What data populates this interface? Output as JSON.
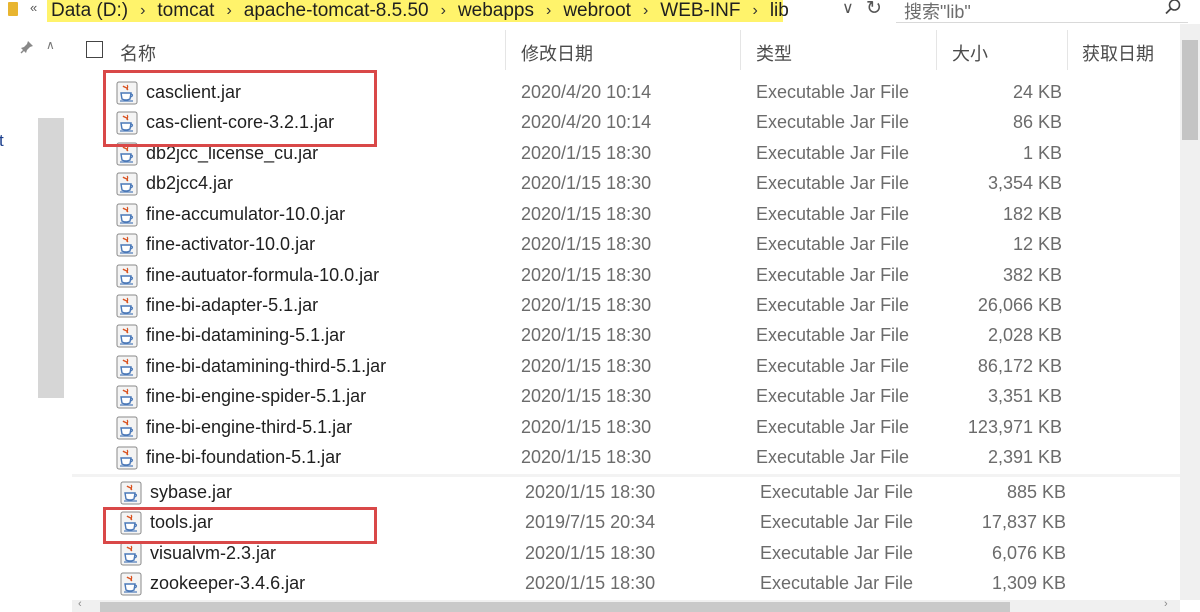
{
  "address": {
    "back_glyph": "«",
    "crumbs": [
      "Data (D:)",
      "tomcat",
      "apache-tomcat-8.5.50",
      "webapps",
      "webroot",
      "WEB-INF",
      "lib"
    ],
    "separator": "›",
    "dropdown_glyph": "∨",
    "refresh_glyph": "↻",
    "highlight_color": "#fff36b"
  },
  "search": {
    "placeholder": "搜索\"lib\"",
    "icon": "search-icon"
  },
  "nav": {
    "pin_glyph": "📌",
    "fragment": "t",
    "up_glyph": "∧"
  },
  "columns": {
    "name": "名称",
    "date": "修改日期",
    "type": "类型",
    "size": "大小",
    "acquired": "获取日期"
  },
  "files": [
    {
      "name": "casclient.jar",
      "date": "2020/4/20 10:14",
      "type": "Executable Jar File",
      "size": "24 KB"
    },
    {
      "name": "cas-client-core-3.2.1.jar",
      "date": "2020/4/20 10:14",
      "type": "Executable Jar File",
      "size": "86 KB"
    },
    {
      "name": "db2jcc_license_cu.jar",
      "date": "2020/1/15 18:30",
      "type": "Executable Jar File",
      "size": "1 KB"
    },
    {
      "name": "db2jcc4.jar",
      "date": "2020/1/15 18:30",
      "type": "Executable Jar File",
      "size": "3,354 KB"
    },
    {
      "name": "fine-accumulator-10.0.jar",
      "date": "2020/1/15 18:30",
      "type": "Executable Jar File",
      "size": "182 KB"
    },
    {
      "name": "fine-activator-10.0.jar",
      "date": "2020/1/15 18:30",
      "type": "Executable Jar File",
      "size": "12 KB"
    },
    {
      "name": "fine-autuator-formula-10.0.jar",
      "date": "2020/1/15 18:30",
      "type": "Executable Jar File",
      "size": "382 KB"
    },
    {
      "name": "fine-bi-adapter-5.1.jar",
      "date": "2020/1/15 18:30",
      "type": "Executable Jar File",
      "size": "26,066 KB"
    },
    {
      "name": "fine-bi-datamining-5.1.jar",
      "date": "2020/1/15 18:30",
      "type": "Executable Jar File",
      "size": "2,028 KB"
    },
    {
      "name": "fine-bi-datamining-third-5.1.jar",
      "date": "2020/1/15 18:30",
      "type": "Executable Jar File",
      "size": "86,172 KB"
    },
    {
      "name": "fine-bi-engine-spider-5.1.jar",
      "date": "2020/1/15 18:30",
      "type": "Executable Jar File",
      "size": "3,351 KB"
    },
    {
      "name": "fine-bi-engine-third-5.1.jar",
      "date": "2020/1/15 18:30",
      "type": "Executable Jar File",
      "size": "123,971 KB"
    },
    {
      "name": "fine-bi-foundation-5.1.jar",
      "date": "2020/1/15 18:30",
      "type": "Executable Jar File",
      "size": "2,391 KB"
    },
    {
      "name": "sybase.jar",
      "date": "2020/1/15 18:30",
      "type": "Executable Jar File",
      "size": "885 KB"
    },
    {
      "name": "tools.jar",
      "date": "2019/7/15 20:34",
      "type": "Executable Jar File",
      "size": "17,837 KB"
    },
    {
      "name": "visualvm-2.3.jar",
      "date": "2020/1/15 18:30",
      "type": "Executable Jar File",
      "size": "6,076 KB"
    },
    {
      "name": "zookeeper-3.4.6.jar",
      "date": "2020/1/15 18:30",
      "type": "Executable Jar File",
      "size": "1,309 KB"
    }
  ],
  "colors": {
    "highlight_box": "#d94848",
    "muted_text": "#6b6b6b"
  }
}
